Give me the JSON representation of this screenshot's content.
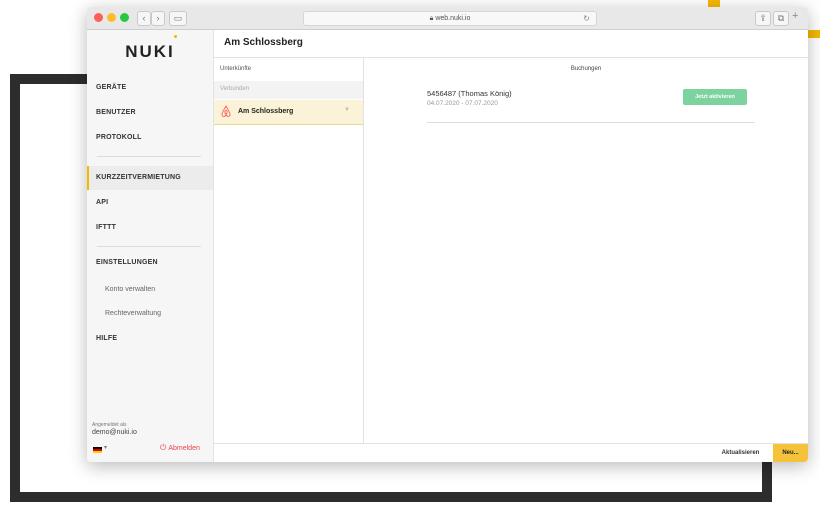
{
  "browser": {
    "url": "web.nuki.io",
    "reload_glyph": "↻"
  },
  "sidebar": {
    "logo": "NUKI",
    "nav": {
      "devices": "GERÄTE",
      "users": "BENUTZER",
      "protocol": "PROTOKOLL",
      "short_term_rental": "KURZZEITVERMIETUNG",
      "api": "API",
      "ifttt": "IFTTT",
      "settings": "EINSTELLUNGEN",
      "manage_account": "Konto verwalten",
      "rights_management": "Rechteverwaltung",
      "help": "HILFE"
    },
    "account": {
      "logged_in_label": "Angemeldet als",
      "email": "demo@nuki.io",
      "logout": "Abmelden"
    }
  },
  "header": {
    "title": "Am Schlossberg"
  },
  "accommodations": {
    "heading": "Unterkünfte",
    "group_label": "Verbunden",
    "items": [
      {
        "name": "Am Schlossberg",
        "icon": "airbnb-icon"
      }
    ]
  },
  "bookings": {
    "heading": "Buchungen",
    "items": [
      {
        "title": "5456487 (Thomas König)",
        "dates": "04.07.2020 - 07.07.2020",
        "action": "Jetzt aktivieren"
      }
    ]
  },
  "footer": {
    "refresh": "Aktualisieren",
    "new": "Neu..."
  },
  "colors": {
    "accent": "#f5b800",
    "activate_button": "#7dd39d",
    "logout": "#e8444a"
  }
}
